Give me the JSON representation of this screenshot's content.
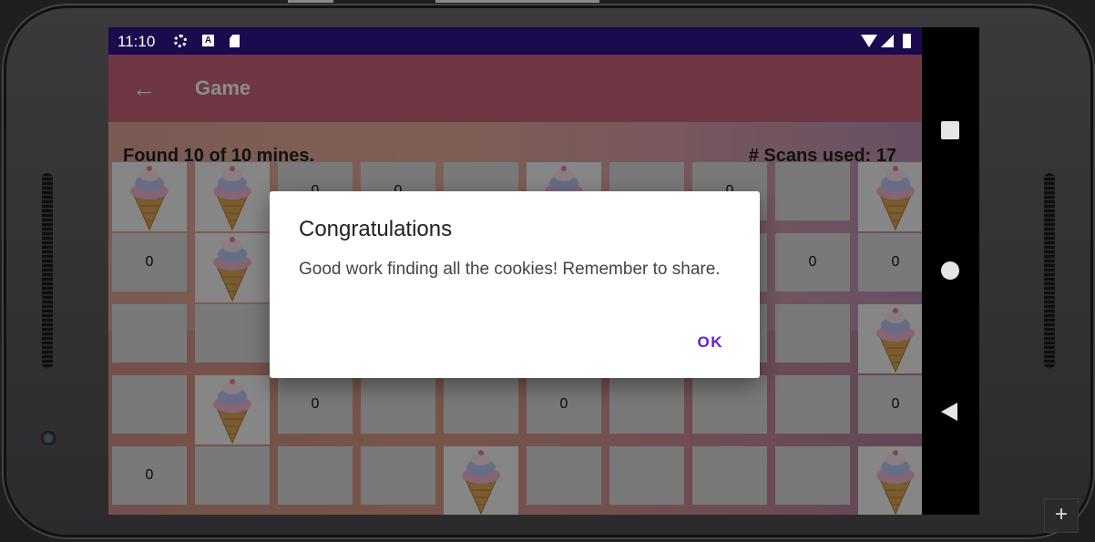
{
  "status": {
    "time": "11:10"
  },
  "toolbar": {
    "title": "Game"
  },
  "game": {
    "found_text": "Found 10 of 10 mines.",
    "scans_text": "# Scans used: 17",
    "rows": [
      [
        "cone",
        "cone",
        "0",
        "0",
        "",
        "cone",
        "",
        "0",
        "",
        "cone"
      ],
      [
        "0",
        "cone",
        "",
        "",
        "",
        "",
        "",
        "",
        "0",
        "0"
      ],
      [
        "",
        "",
        "",
        "",
        "",
        "",
        "",
        "",
        "",
        "cone"
      ],
      [
        "",
        "cone",
        "0",
        "",
        "",
        "0",
        "",
        "",
        "",
        "0"
      ],
      [
        "0",
        "",
        "",
        "",
        "cone",
        "",
        "",
        "",
        "",
        "cone"
      ]
    ]
  },
  "dialog": {
    "title": "Congratulations",
    "message": "Good work finding all the cookies! Remember to share.",
    "ok_label": "OK"
  }
}
